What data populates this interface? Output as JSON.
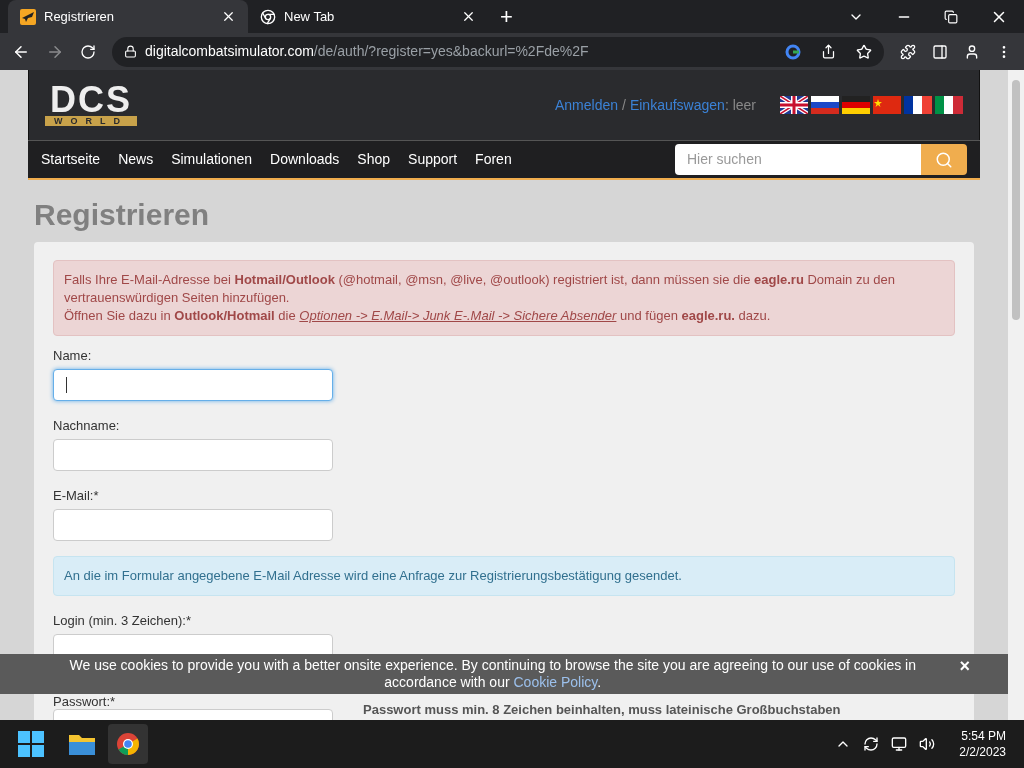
{
  "browser": {
    "tabs": [
      {
        "title": "Registrieren",
        "selected": true,
        "kind": "site"
      },
      {
        "title": "New Tab",
        "selected": false,
        "kind": "chrome"
      }
    ],
    "new_tab": "+",
    "url_host": "digitalcombatsimulator.com",
    "url_path": "/de/auth/?register=yes&backurl=%2Fde%2F"
  },
  "header": {
    "logo": "DCS",
    "logo_sub": "WORLD",
    "login_link": "Anmelden",
    "separator": "/",
    "cart_link": "Einkaufswagen",
    "cart_status": ": leer"
  },
  "nav": {
    "items": [
      "Startseite",
      "News",
      "Simulationen",
      "Downloads",
      "Shop",
      "Support",
      "Foren"
    ],
    "search_placeholder": "Hier suchen"
  },
  "page_title": "Registrieren",
  "alert": {
    "line_1": "Falls Ihre E-Mail-Adresse bei **Hotmail/Outlook** (@hotmail, @msn, @live, @outlook) registriert ist, dann müssen sie die **eagle.ru** Domain zu den vertrauenswürdigen Seiten hinzufügen.",
    "line_2_before": "Öffnen Sie dazu in **Outlook/Hotmail** die",
    "link": "Optionen -> E.Mail-> Junk E-.Mail -> Sichere Absender",
    "line_2_after": "und fügen **eagle.ru.** dazu."
  },
  "form": [
    {
      "kind": "field",
      "label": "Name:",
      "focused": true
    },
    {
      "kind": "field",
      "label": "Nachname:",
      "focused": false
    },
    {
      "kind": "field",
      "label": "E-Mail:*",
      "focused": false
    },
    {
      "kind": "info",
      "text": "An die im Formular angegebene E-Mail Adresse wird eine Anfrage zur Registrierungsbestätigung gesendet."
    },
    {
      "kind": "field",
      "label": "Login (min. 3 Zeichen):*",
      "focused": false
    },
    {
      "kind": "field",
      "label": "Passwort:*",
      "focused": false,
      "hint": "Passwort muss min. 8 Zeichen beinhalten, muss lateinische Großbuchstaben"
    }
  ],
  "cookie_bar": {
    "text": "We use cookies to provide you with a better onsite experience. By continuing to browse the site you are agreeing to our use of cookies in accordance with our",
    "link": "Cookie Policy",
    "end": ".",
    "close": "×"
  },
  "taskbar": {
    "time": "5:54 PM",
    "date": "2/2/2023"
  }
}
